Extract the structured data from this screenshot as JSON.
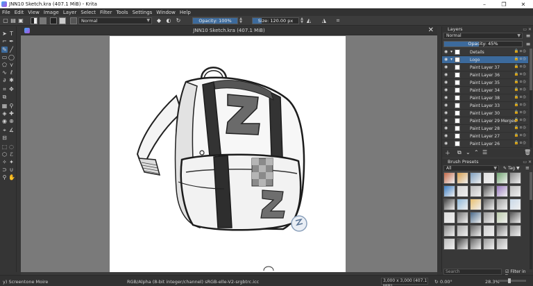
{
  "window": {
    "title": "JNN10 Sketch.kra (407.1 MiB) - Krita",
    "minimize": "–",
    "restore": "❐",
    "close": "✕"
  },
  "menu": [
    "File",
    "Edit",
    "View",
    "Image",
    "Layer",
    "Select",
    "Filter",
    "Tools",
    "Settings",
    "Window",
    "Help"
  ],
  "toolbar": {
    "blend_mode": "Normal",
    "opacity": {
      "label": "Opacity: 100%",
      "value": 1.0
    },
    "size": {
      "label": "Size: 120.00 px",
      "value": 0.2
    }
  },
  "document": {
    "tab_title": "JNN10 Sketch.kra (407.1 MiB)",
    "close": "✕"
  },
  "layers": {
    "title": "Layers",
    "blend_mode": "Normal",
    "opacity_label": "Opacity:  45%",
    "opacity_value": 0.45,
    "rows": [
      {
        "name": "Details",
        "selected": false,
        "group": true
      },
      {
        "name": "Logo",
        "selected": true,
        "group": true
      },
      {
        "name": "Paint Layer 37",
        "selected": false
      },
      {
        "name": "Paint Layer 36",
        "selected": false
      },
      {
        "name": "Paint Layer 35",
        "selected": false
      },
      {
        "name": "Paint Layer 34",
        "selected": false
      },
      {
        "name": "Paint Layer 38",
        "selected": false
      },
      {
        "name": "Paint Layer 33",
        "selected": false
      },
      {
        "name": "Paint Layer 30",
        "selected": false
      },
      {
        "name": "Paint Layer 29 Merged",
        "selected": false
      },
      {
        "name": "Paint Layer 28",
        "selected": false
      },
      {
        "name": "Paint Layer 27",
        "selected": false
      },
      {
        "name": "Paint Layer 26",
        "selected": false
      }
    ]
  },
  "brush_presets": {
    "title": "Brush Presets",
    "filter": "All",
    "tag_label": "Tag",
    "search_placeholder": "Search",
    "filter_in_tag": "Filter in Tag"
  },
  "status": {
    "brush": "y) Screentone Moire",
    "color_info": "RGB/Alpha (8-bit integer/channel)  sRGB-elle-V2-srgbtrc.icc",
    "doc_size": "3,000 x 3,000 (407.1 MiB)",
    "rotation": "0.00°",
    "zoom": "28.3%"
  },
  "colors": {
    "accent": "#3c6a9c",
    "bg": "#353535"
  }
}
